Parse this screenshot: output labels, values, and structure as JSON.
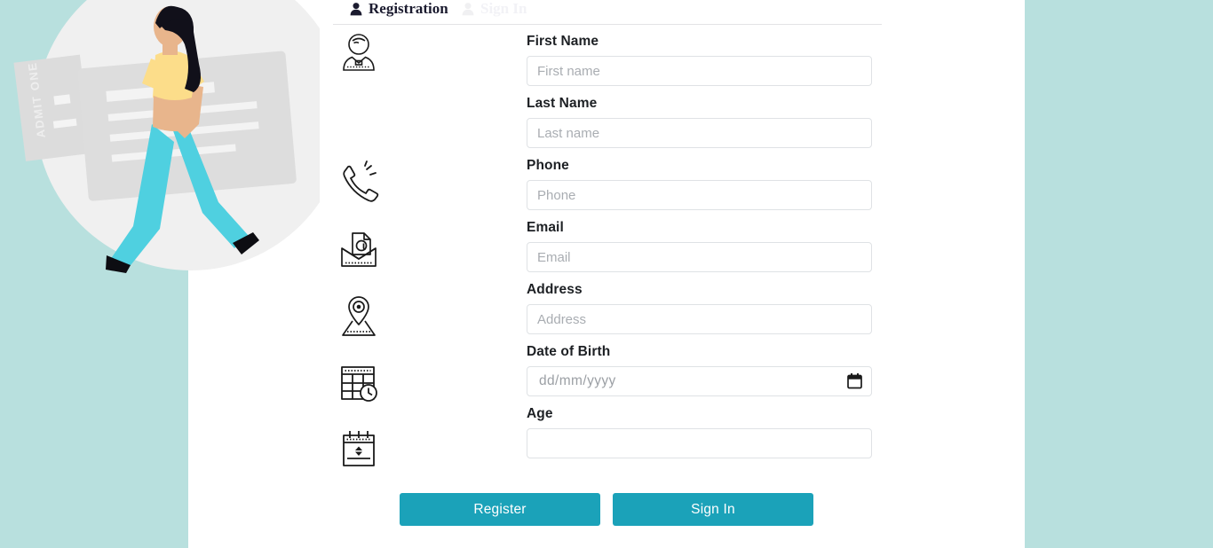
{
  "page": {
    "background_color": "#b8e0de",
    "card_background": "#ffffff",
    "accent_color": "#1ba2b9"
  },
  "header": {
    "tabs": [
      {
        "label": "Registration",
        "icon": "person-icon",
        "active": true
      },
      {
        "label": "Sign In",
        "icon": "person-icon",
        "active": false
      }
    ]
  },
  "illustration": {
    "name": "walking-woman-with-ticket-illustration",
    "ticket_text": "ADMIT ONE",
    "colors": {
      "circle": "#f0f0f0",
      "ticket": "#d9d9d9",
      "shirt": "#fcdd8a",
      "pants": "#4fd0e0",
      "skin": "#e8b58c",
      "hair": "#11101a",
      "shoes": "#0d0d12"
    }
  },
  "form": {
    "fields": [
      {
        "id": "first-name",
        "label": "First Name",
        "placeholder": "First name",
        "value": "",
        "icon": "user-profile-icon",
        "type": "text"
      },
      {
        "id": "last-name",
        "label": "Last Name",
        "placeholder": "Last name",
        "value": "",
        "icon": "",
        "type": "text"
      },
      {
        "id": "phone",
        "label": "Phone",
        "placeholder": "Phone",
        "value": "",
        "icon": "telephone-icon",
        "type": "tel"
      },
      {
        "id": "email",
        "label": "Email",
        "placeholder": "Email",
        "value": "",
        "icon": "email-envelope-icon",
        "type": "email"
      },
      {
        "id": "address",
        "label": "Address",
        "placeholder": "Address",
        "value": "",
        "icon": "map-location-pin-icon",
        "type": "text"
      },
      {
        "id": "date-of-birth",
        "label": "Date of Birth",
        "placeholder": "dd/mm/yyyy",
        "value": "",
        "icon": "calendar-clock-icon",
        "type": "date"
      },
      {
        "id": "age",
        "label": "Age",
        "placeholder": "",
        "value": "",
        "icon": "calendar-stepper-icon",
        "type": "number"
      }
    ]
  },
  "actions": {
    "register_label": "Register",
    "signin_label": "Sign In"
  }
}
